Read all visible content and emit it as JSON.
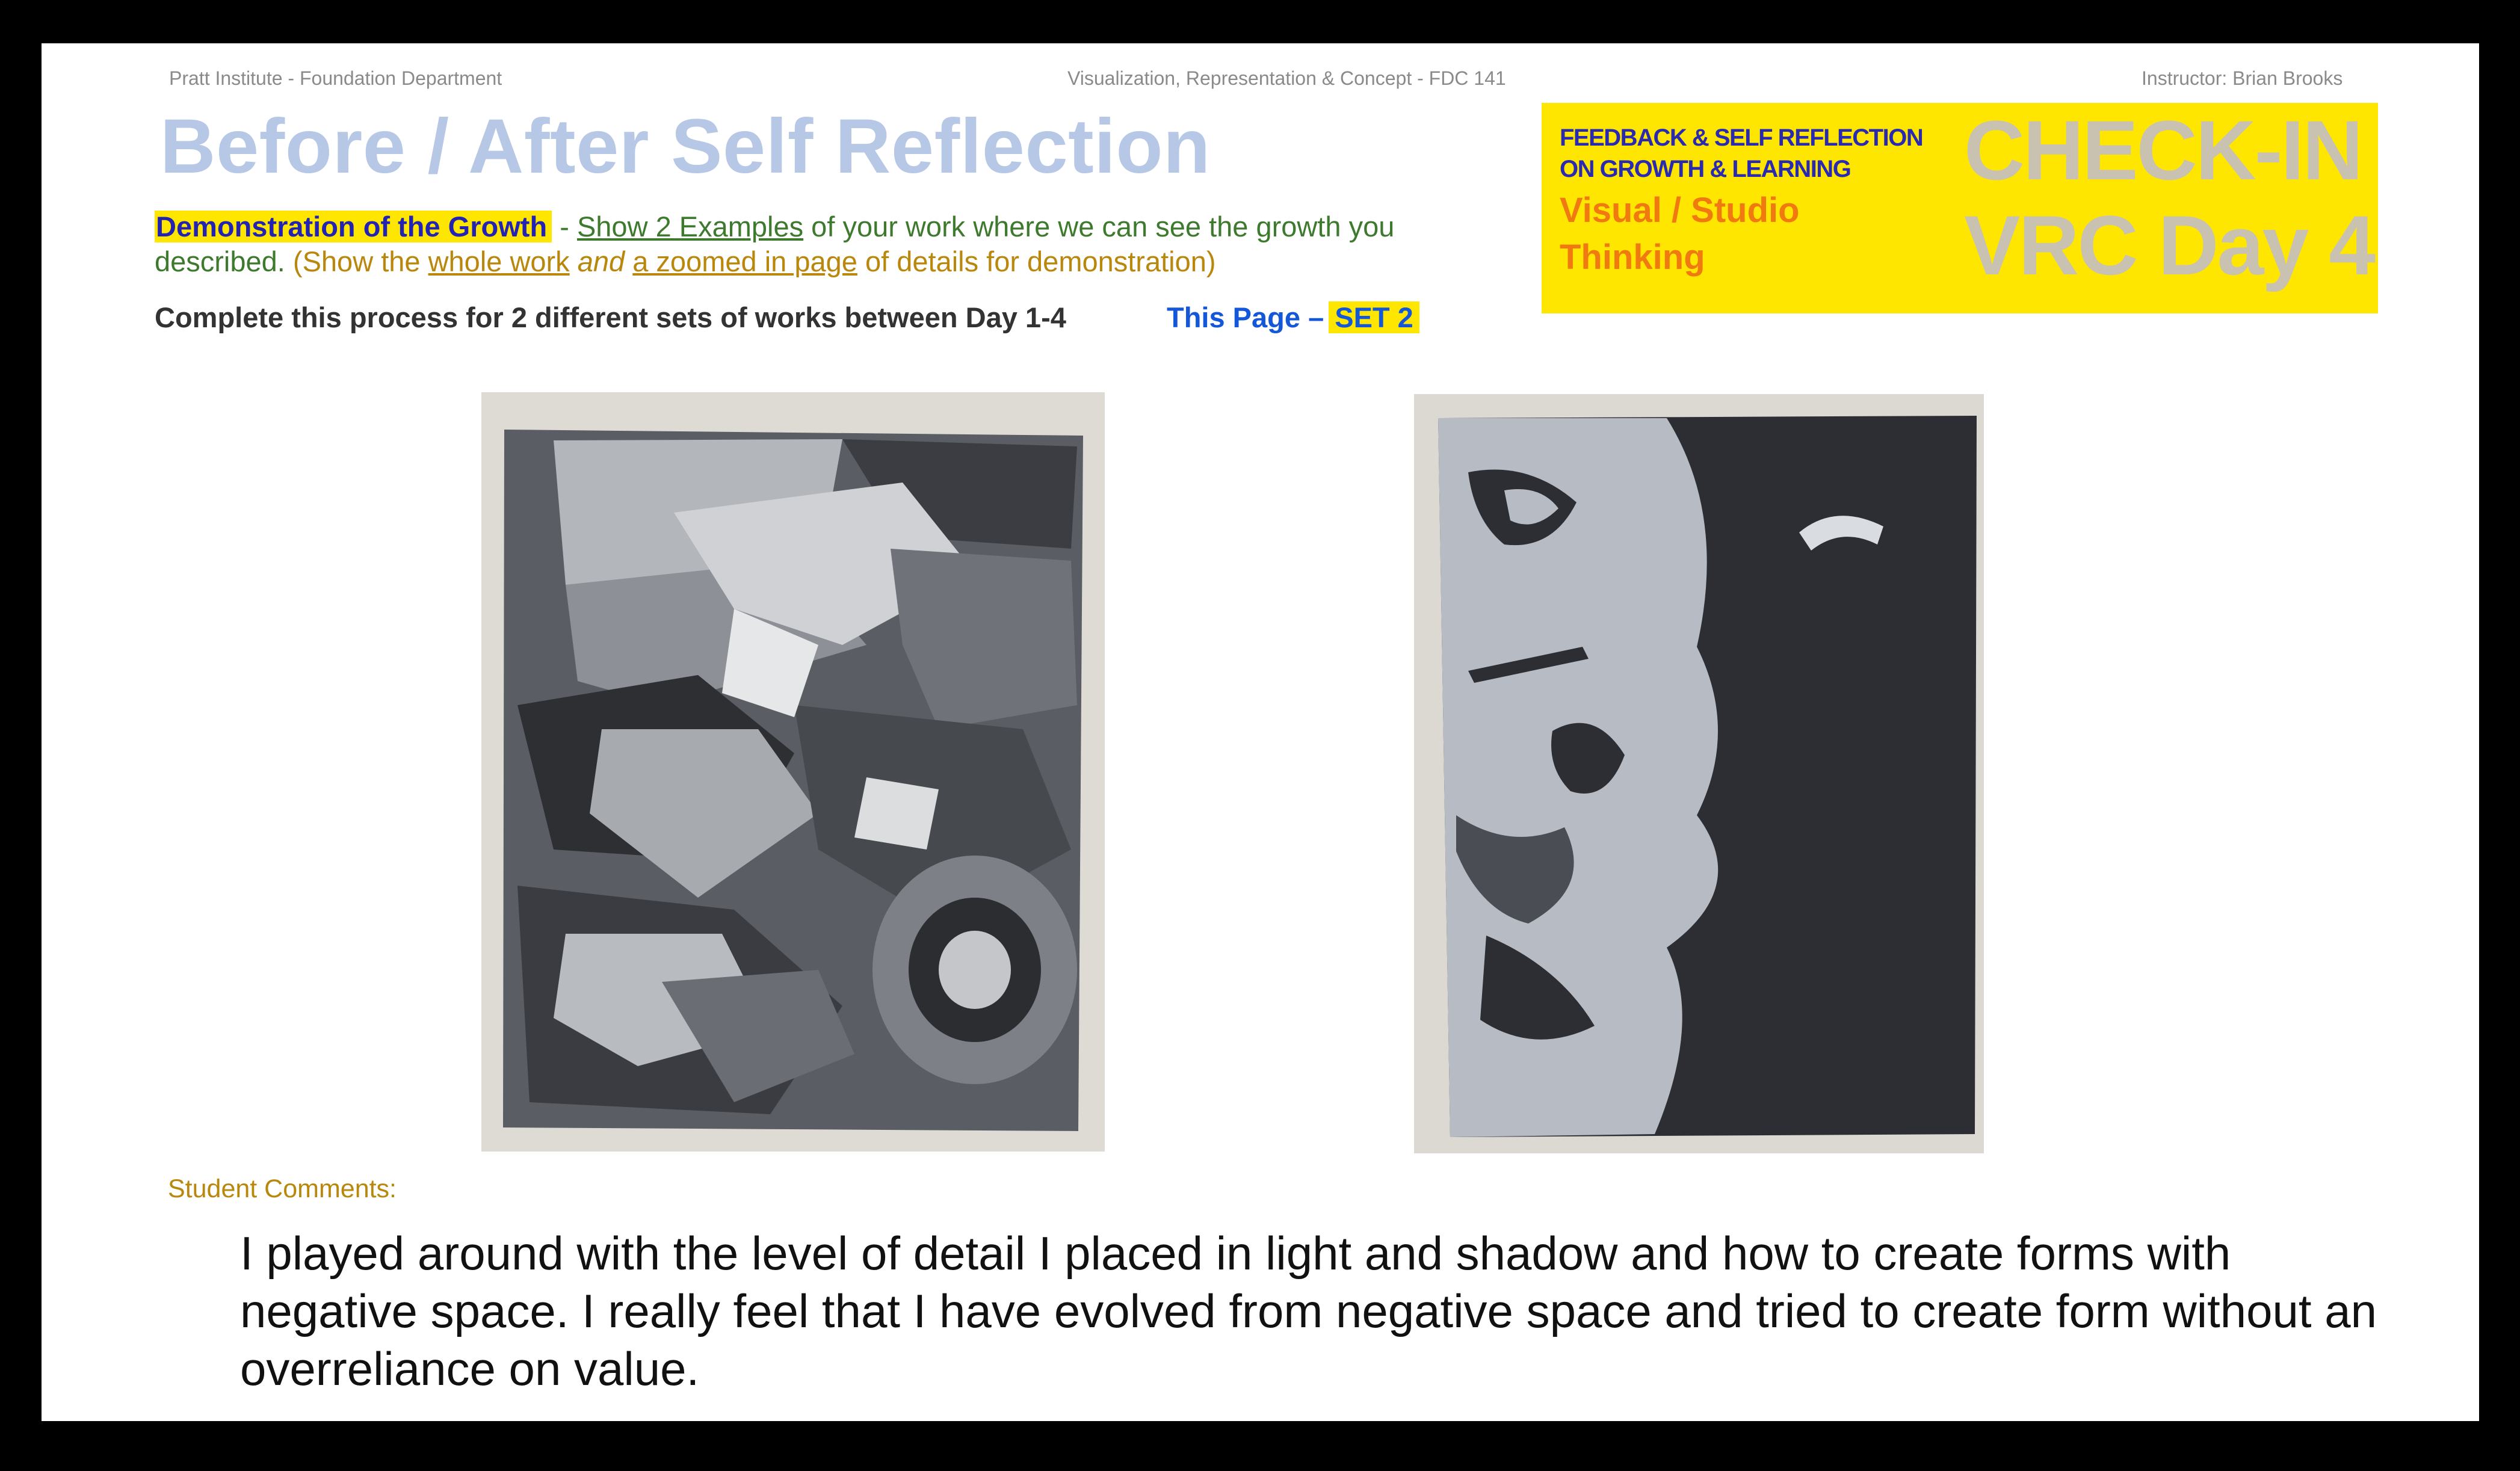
{
  "header": {
    "left": "Pratt Institute - Foundation Department",
    "center": "Visualization, Representation & Concept - FDC 141",
    "right": "Instructor: Brian Brooks"
  },
  "title": "Before / After Self Reflection",
  "demo": {
    "highlight": "Demonstration of the Growth",
    "dash": " - ",
    "link1": "Show 2 Examples",
    "text1": " of your work where we can see the growth you described.",
    "paren_open": "  (Show the ",
    "link2": "whole work",
    "and": " and ",
    "link3": "a zoomed in page",
    "paren_close": " of details for demonstration)"
  },
  "complete_text": "Complete this process for 2 different sets of works between Day 1-4",
  "this_page": "This Page –",
  "set_label": "SET 2",
  "badge": {
    "line1": "FEEDBACK & SELF REFLECTION",
    "line2": "ON GROWTH & LEARNING",
    "sub1": "Visual / Studio",
    "sub2": "Thinking",
    "checkin1": "CHECK-IN",
    "checkin2": "VRC Day 4"
  },
  "images": {
    "before": "abstract-value-painting",
    "after": "negative-space-face-painting"
  },
  "comments_label": "Student Comments:",
  "comment": "I played around with the level of detail I placed in light and shadow and how to create forms with negative space. I really feel that I have evolved from negative space and tried to create form without an overreliance on value."
}
